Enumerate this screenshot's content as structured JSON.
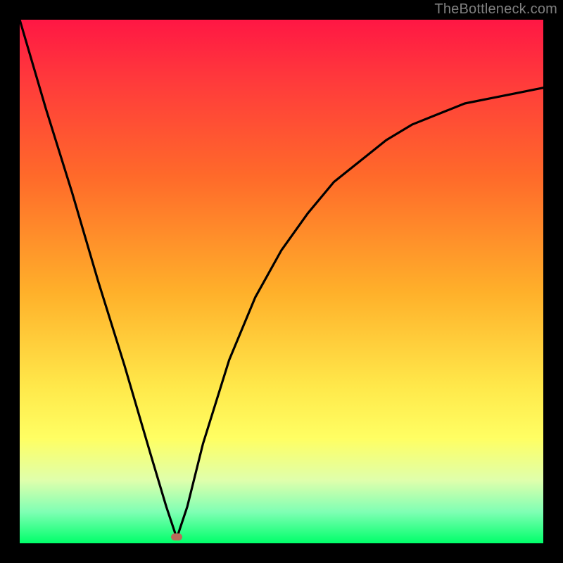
{
  "attribution": "TheBottleneck.com",
  "colors": {
    "frame": "#000000",
    "gradient_top": "#ff1744",
    "gradient_bottom": "#00ff6a",
    "curve": "#000000",
    "marker": "#b96b5a"
  },
  "chart_data": {
    "type": "line",
    "title": "",
    "xlabel": "",
    "ylabel": "",
    "xlim": [
      0,
      100
    ],
    "ylim": [
      0,
      100
    ],
    "grid": false,
    "legend": false,
    "minimum_at_x": 30,
    "series": [
      {
        "name": "bottleneck-curve",
        "x": [
          0,
          5,
          10,
          15,
          20,
          25,
          28,
          30,
          32,
          35,
          40,
          45,
          50,
          55,
          60,
          65,
          70,
          75,
          80,
          85,
          90,
          95,
          100
        ],
        "values": [
          100,
          83,
          67,
          50,
          34,
          17,
          7,
          1,
          7,
          19,
          35,
          47,
          56,
          63,
          69,
          73,
          77,
          80,
          82,
          84,
          85,
          86,
          87
        ]
      }
    ],
    "marker": {
      "x": 30,
      "y": 1
    }
  }
}
